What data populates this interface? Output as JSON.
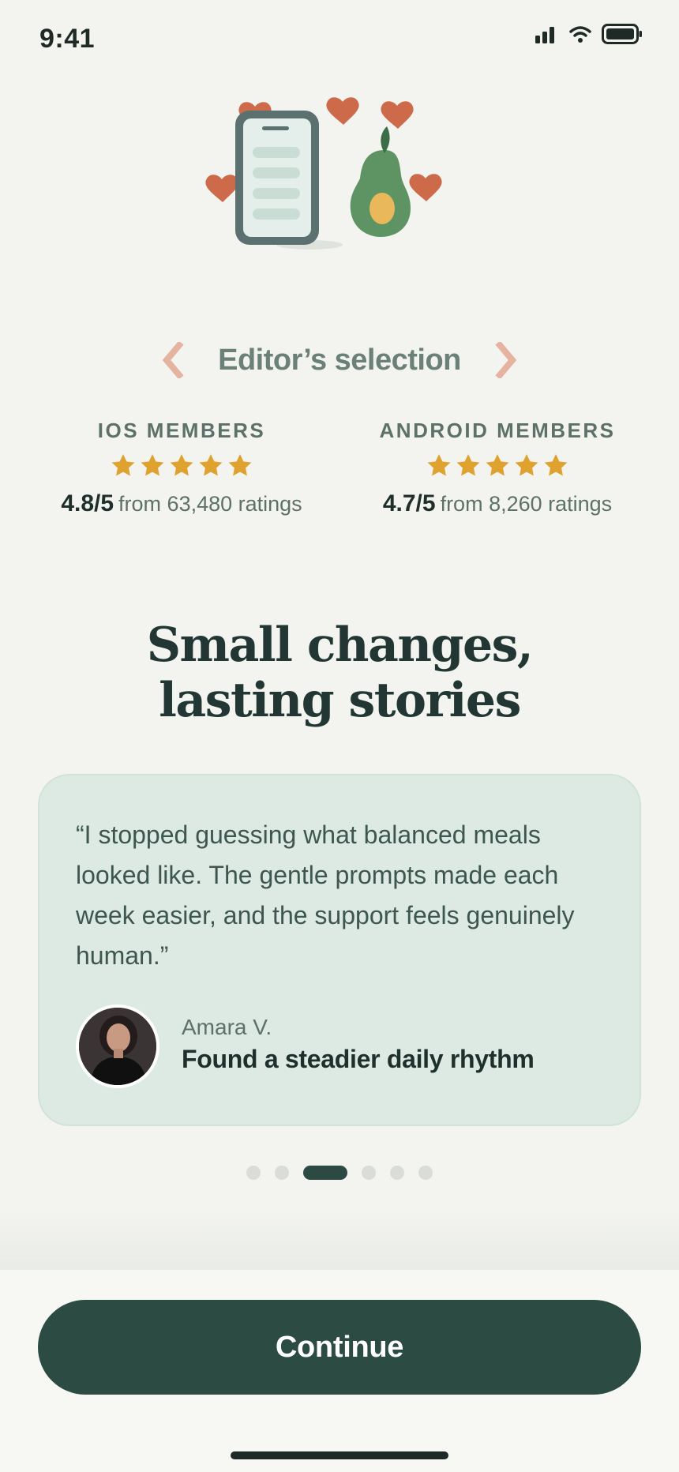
{
  "status_bar": {
    "time": "9:41",
    "icons": [
      "signal-icon",
      "wifi-icon",
      "battery-icon"
    ]
  },
  "hero": {
    "illustration": "phone-avocado-hearts-illustration"
  },
  "editor": {
    "title": "Editor’s selection",
    "left_icon": "laurel-left-chevron-icon",
    "right_icon": "laurel-right-chevron-icon"
  },
  "ratings": {
    "ios": {
      "label": "IOS MEMBERS",
      "stars": 5,
      "score": "4.8/5",
      "detail": "from 63,480 ratings"
    },
    "android": {
      "label": "ANDROID MEMBERS",
      "stars": 5,
      "score": "4.7/5",
      "detail": "from 8,260 ratings"
    }
  },
  "headline": {
    "line1": "Small changes,",
    "line2": "lasting stories"
  },
  "testimonial": {
    "quote": "“I stopped guessing what balanced meals looked like. The gentle prompts made each week easier, and the support feels genuinely human.”",
    "author_name": "Amara V.",
    "author_result": "Found a steadier daily rhythm"
  },
  "pager": {
    "count": 6,
    "active_index": 2
  },
  "footer": {
    "continue_label": "Continue"
  },
  "colors": {
    "background": "#f3f4f0",
    "accent": "#2c4b43",
    "card": "#dceae3",
    "star": "#e0a22e",
    "heart": "#cc6a4a",
    "laurel": "#e5b3a0"
  }
}
